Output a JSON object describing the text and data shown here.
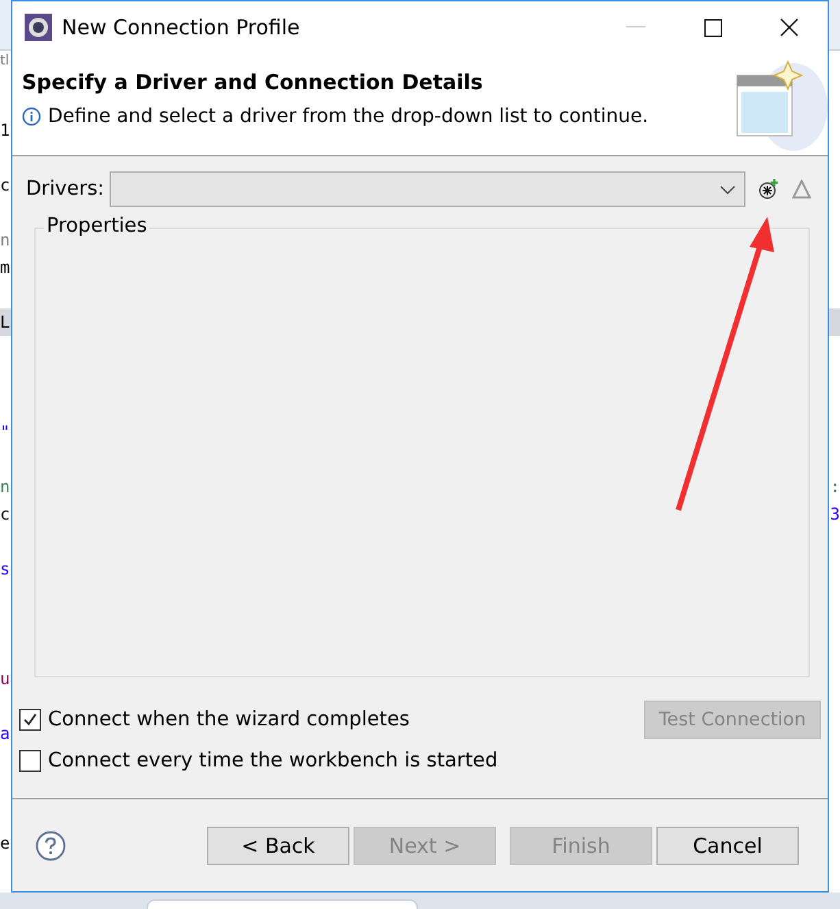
{
  "background": {
    "tab_fragment": "tl",
    "lines": [
      {
        "highlighted": false,
        "left": {
          "text": "1",
          "color": "#000000"
        }
      },
      {
        "highlighted": false
      },
      {
        "highlighted": false,
        "left": {
          "text": "c",
          "color": "#000000"
        }
      },
      {
        "highlighted": false
      },
      {
        "highlighted": false,
        "left": {
          "text": "n",
          "color": "#808080"
        }
      },
      {
        "highlighted": false,
        "left": {
          "text": "m",
          "color": "#000000"
        }
      },
      {
        "highlighted": false
      },
      {
        "highlighted": true,
        "left": {
          "text": "L",
          "color": "#000000"
        }
      },
      {
        "highlighted": false
      },
      {
        "highlighted": false
      },
      {
        "highlighted": false
      },
      {
        "highlighted": false,
        "left": {
          "text": "\"",
          "color": "#2a00ff"
        }
      },
      {
        "highlighted": false
      },
      {
        "highlighted": false,
        "left": {
          "text": "n",
          "color": "#3f7f5f"
        },
        "right": {
          "text": ":",
          "color": "#3f7f5f"
        }
      },
      {
        "highlighted": false,
        "left": {
          "text": "c",
          "color": "#000000"
        },
        "right": {
          "text": "3",
          "color": "#2a00ff"
        }
      },
      {
        "highlighted": false
      },
      {
        "highlighted": false,
        "left": {
          "text": "s",
          "color": "#2a00ff"
        }
      },
      {
        "highlighted": false
      },
      {
        "highlighted": false
      },
      {
        "highlighted": false
      },
      {
        "highlighted": false,
        "left": {
          "text": "u",
          "color": "#7f0055"
        }
      },
      {
        "highlighted": false
      },
      {
        "highlighted": false,
        "left": {
          "text": "a",
          "color": "#2a00ff"
        }
      },
      {
        "highlighted": false
      },
      {
        "highlighted": false
      },
      {
        "highlighted": false
      },
      {
        "highlighted": false,
        "left": {
          "text": "e",
          "color": "#000000"
        }
      }
    ]
  },
  "window": {
    "title": "New Connection Profile"
  },
  "header": {
    "title": "Specify a Driver and Connection Details",
    "message": "Define and select a driver from the drop-down list to continue."
  },
  "drivers": {
    "label": "Drivers:"
  },
  "properties": {
    "title": "Properties"
  },
  "options": [
    {
      "label": "Connect when the wizard completes",
      "checked": true
    },
    {
      "label": "Connect every time the workbench is started",
      "checked": false
    }
  ],
  "test_button": {
    "label": "Test Connection",
    "disabled": true
  },
  "buttons": [
    {
      "label": "< Back",
      "disabled": false
    },
    {
      "label": "Next >",
      "disabled": true
    },
    {
      "label": "Finish",
      "disabled": true
    },
    {
      "label": "Cancel",
      "disabled": false
    }
  ]
}
